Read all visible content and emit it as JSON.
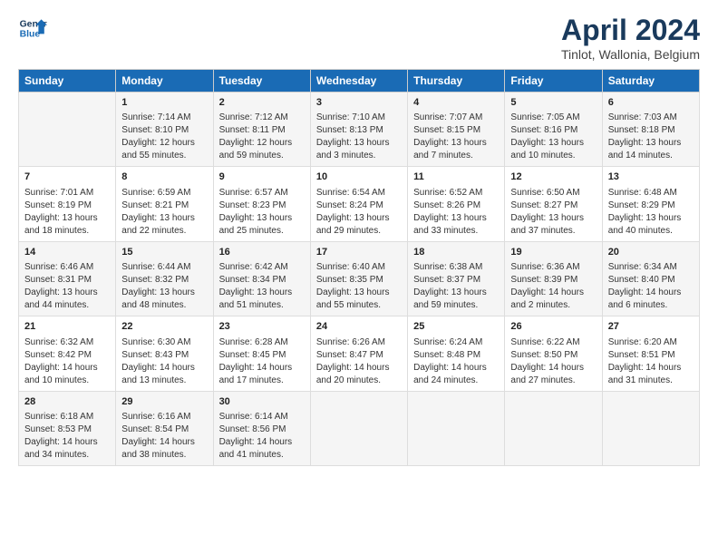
{
  "header": {
    "logo_line1": "General",
    "logo_line2": "Blue",
    "title": "April 2024",
    "subtitle": "Tinlot, Wallonia, Belgium"
  },
  "columns": [
    "Sunday",
    "Monday",
    "Tuesday",
    "Wednesday",
    "Thursday",
    "Friday",
    "Saturday"
  ],
  "weeks": [
    [
      {
        "day": "",
        "info": ""
      },
      {
        "day": "1",
        "info": "Sunrise: 7:14 AM\nSunset: 8:10 PM\nDaylight: 12 hours\nand 55 minutes."
      },
      {
        "day": "2",
        "info": "Sunrise: 7:12 AM\nSunset: 8:11 PM\nDaylight: 12 hours\nand 59 minutes."
      },
      {
        "day": "3",
        "info": "Sunrise: 7:10 AM\nSunset: 8:13 PM\nDaylight: 13 hours\nand 3 minutes."
      },
      {
        "day": "4",
        "info": "Sunrise: 7:07 AM\nSunset: 8:15 PM\nDaylight: 13 hours\nand 7 minutes."
      },
      {
        "day": "5",
        "info": "Sunrise: 7:05 AM\nSunset: 8:16 PM\nDaylight: 13 hours\nand 10 minutes."
      },
      {
        "day": "6",
        "info": "Sunrise: 7:03 AM\nSunset: 8:18 PM\nDaylight: 13 hours\nand 14 minutes."
      }
    ],
    [
      {
        "day": "7",
        "info": "Sunrise: 7:01 AM\nSunset: 8:19 PM\nDaylight: 13 hours\nand 18 minutes."
      },
      {
        "day": "8",
        "info": "Sunrise: 6:59 AM\nSunset: 8:21 PM\nDaylight: 13 hours\nand 22 minutes."
      },
      {
        "day": "9",
        "info": "Sunrise: 6:57 AM\nSunset: 8:23 PM\nDaylight: 13 hours\nand 25 minutes."
      },
      {
        "day": "10",
        "info": "Sunrise: 6:54 AM\nSunset: 8:24 PM\nDaylight: 13 hours\nand 29 minutes."
      },
      {
        "day": "11",
        "info": "Sunrise: 6:52 AM\nSunset: 8:26 PM\nDaylight: 13 hours\nand 33 minutes."
      },
      {
        "day": "12",
        "info": "Sunrise: 6:50 AM\nSunset: 8:27 PM\nDaylight: 13 hours\nand 37 minutes."
      },
      {
        "day": "13",
        "info": "Sunrise: 6:48 AM\nSunset: 8:29 PM\nDaylight: 13 hours\nand 40 minutes."
      }
    ],
    [
      {
        "day": "14",
        "info": "Sunrise: 6:46 AM\nSunset: 8:31 PM\nDaylight: 13 hours\nand 44 minutes."
      },
      {
        "day": "15",
        "info": "Sunrise: 6:44 AM\nSunset: 8:32 PM\nDaylight: 13 hours\nand 48 minutes."
      },
      {
        "day": "16",
        "info": "Sunrise: 6:42 AM\nSunset: 8:34 PM\nDaylight: 13 hours\nand 51 minutes."
      },
      {
        "day": "17",
        "info": "Sunrise: 6:40 AM\nSunset: 8:35 PM\nDaylight: 13 hours\nand 55 minutes."
      },
      {
        "day": "18",
        "info": "Sunrise: 6:38 AM\nSunset: 8:37 PM\nDaylight: 13 hours\nand 59 minutes."
      },
      {
        "day": "19",
        "info": "Sunrise: 6:36 AM\nSunset: 8:39 PM\nDaylight: 14 hours\nand 2 minutes."
      },
      {
        "day": "20",
        "info": "Sunrise: 6:34 AM\nSunset: 8:40 PM\nDaylight: 14 hours\nand 6 minutes."
      }
    ],
    [
      {
        "day": "21",
        "info": "Sunrise: 6:32 AM\nSunset: 8:42 PM\nDaylight: 14 hours\nand 10 minutes."
      },
      {
        "day": "22",
        "info": "Sunrise: 6:30 AM\nSunset: 8:43 PM\nDaylight: 14 hours\nand 13 minutes."
      },
      {
        "day": "23",
        "info": "Sunrise: 6:28 AM\nSunset: 8:45 PM\nDaylight: 14 hours\nand 17 minutes."
      },
      {
        "day": "24",
        "info": "Sunrise: 6:26 AM\nSunset: 8:47 PM\nDaylight: 14 hours\nand 20 minutes."
      },
      {
        "day": "25",
        "info": "Sunrise: 6:24 AM\nSunset: 8:48 PM\nDaylight: 14 hours\nand 24 minutes."
      },
      {
        "day": "26",
        "info": "Sunrise: 6:22 AM\nSunset: 8:50 PM\nDaylight: 14 hours\nand 27 minutes."
      },
      {
        "day": "27",
        "info": "Sunrise: 6:20 AM\nSunset: 8:51 PM\nDaylight: 14 hours\nand 31 minutes."
      }
    ],
    [
      {
        "day": "28",
        "info": "Sunrise: 6:18 AM\nSunset: 8:53 PM\nDaylight: 14 hours\nand 34 minutes."
      },
      {
        "day": "29",
        "info": "Sunrise: 6:16 AM\nSunset: 8:54 PM\nDaylight: 14 hours\nand 38 minutes."
      },
      {
        "day": "30",
        "info": "Sunrise: 6:14 AM\nSunset: 8:56 PM\nDaylight: 14 hours\nand 41 minutes."
      },
      {
        "day": "",
        "info": ""
      },
      {
        "day": "",
        "info": ""
      },
      {
        "day": "",
        "info": ""
      },
      {
        "day": "",
        "info": ""
      }
    ]
  ]
}
